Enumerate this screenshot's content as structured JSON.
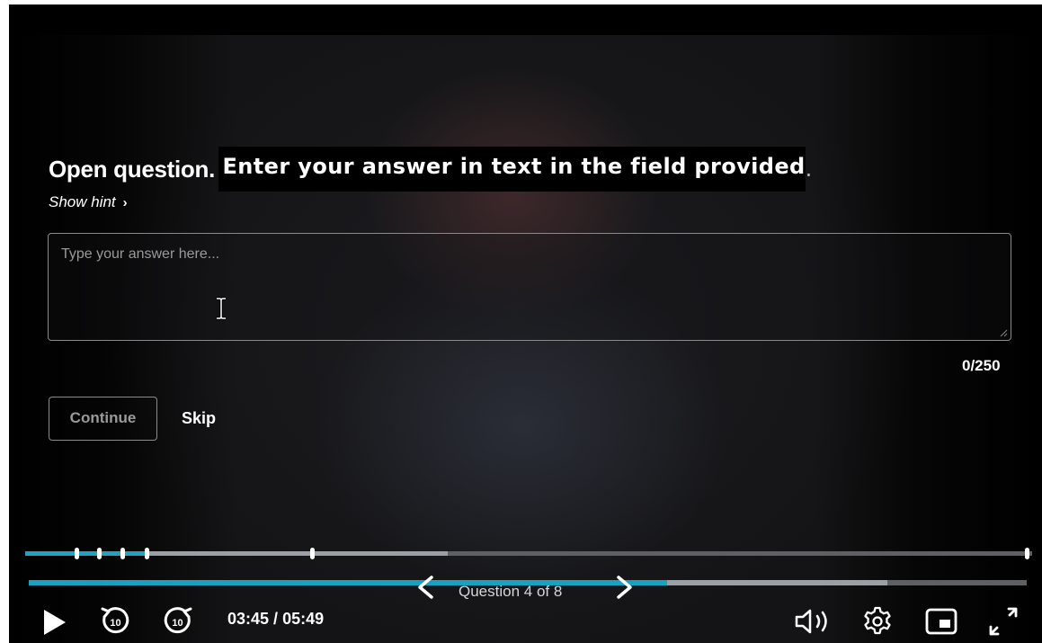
{
  "question": {
    "type_label": "Open question.",
    "instruction_main": "Enter your answer in text in the field provided",
    "instruction_end": ".",
    "hint_label": "Show hint",
    "hint_chevron": "›",
    "answer_placeholder": "Type your answer here...",
    "char_count": "0/250",
    "continue_label": "Continue",
    "skip_label": "Skip"
  },
  "navigation": {
    "question_label": "Question 4 of 8",
    "prev_icon": "chevron-left-icon",
    "next_icon": "chevron-right-icon"
  },
  "player": {
    "current_time": "03:45",
    "separator": " / ",
    "duration": "05:49",
    "rewind_label": "10",
    "forward_label": "10",
    "chapter_progress_fraction": 0.12,
    "chapter_buffer_fraction": 0.42,
    "video_progress_fraction": 0.64,
    "video_buffer_fraction": 0.86,
    "icons": [
      "play-icon",
      "rewind-10-icon",
      "forward-10-icon",
      "volume-icon",
      "settings-icon",
      "picture-in-picture-icon",
      "fullscreen-icon"
    ]
  },
  "colors": {
    "accent": "#1aa0c0",
    "background": "#000000",
    "track": "#5e6064",
    "buffer": "#9ca0a6"
  }
}
